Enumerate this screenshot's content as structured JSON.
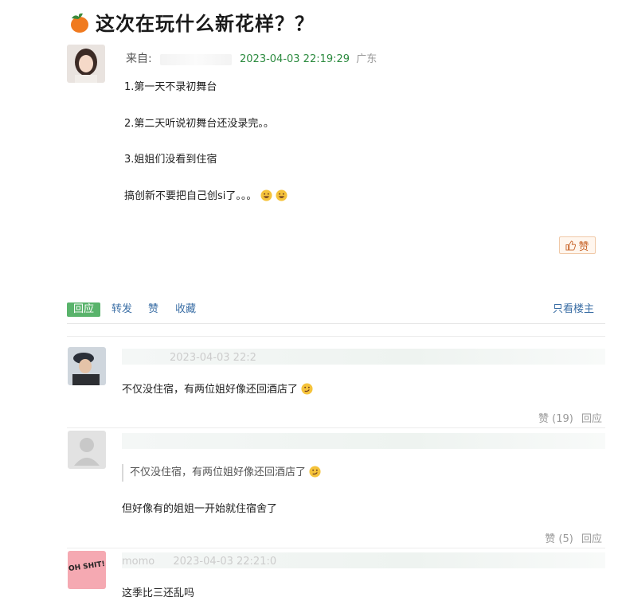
{
  "post": {
    "title": "这次在玩什么新花样？？",
    "from_label": "来自:",
    "time": "2023-04-03 22:19:29",
    "location": "广东",
    "lines": [
      "1.第一天不录初舞台",
      "2.第二天听说初舞台还没录完。。",
      "3.姐姐们没看到住宿",
      "搞创新不要把自己创si了。。。"
    ],
    "like_label": "赞"
  },
  "actions": {
    "reply": "回应",
    "forward": "转发",
    "like": "赞",
    "favorite": "收藏",
    "op_only": "只看楼主"
  },
  "comments": [
    {
      "header": "2023-04-03 22:2",
      "text": "不仅没住宿，有两位姐好像还回酒店了",
      "like": "赞 (19)",
      "reply": "回应"
    },
    {
      "quote": "不仅没住宿，有两位姐好像还回酒店了",
      "text": "但好像有的姐姐一开始就住宿舍了",
      "like": "赞 (5)",
      "reply": "回应"
    },
    {
      "header_name": "momo",
      "header": "2023-04-03 22:21:0",
      "avatar_text": "OH SHIT!",
      "text": "这季比三还乱吗"
    }
  ]
}
